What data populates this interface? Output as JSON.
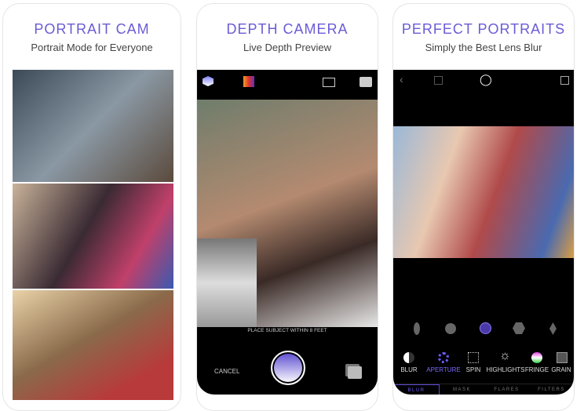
{
  "cards": [
    {
      "title": "PORTRAIT CAM",
      "subtitle": "Portrait Mode for Everyone"
    },
    {
      "title": "DEPTH CAMERA",
      "subtitle": "Live Depth Preview",
      "hint": "PLACE SUBJECT WITHIN 8 FEET",
      "cancel": "CANCEL"
    },
    {
      "title": "PERFECT PORTRAITS",
      "subtitle": "Simply the Best Lens Blur",
      "tools": [
        "BLUR",
        "APERTURE",
        "SPIN",
        "HIGHLIGHTS",
        "FRINGE",
        "GRAIN"
      ],
      "tabs": [
        "BLUR",
        "MASK",
        "FLARES",
        "FILTERS"
      ]
    }
  ],
  "colors": {
    "accent": "#6b5bd6"
  }
}
